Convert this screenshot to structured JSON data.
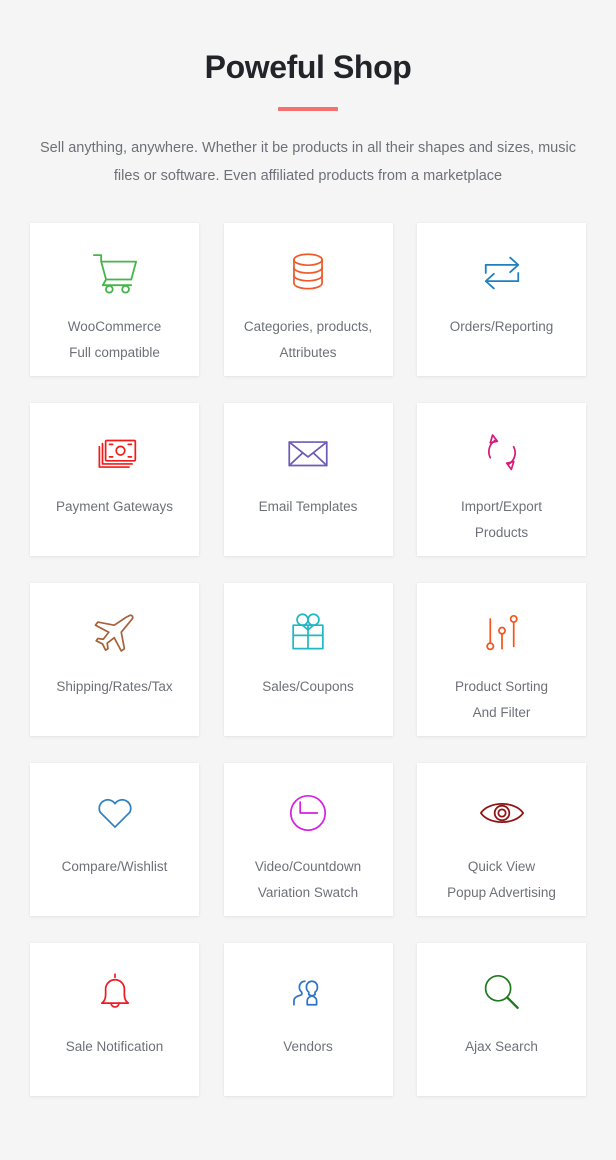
{
  "header": {
    "title": "Poweful Shop",
    "accent_color": "#f4706f",
    "subtitle": "Sell anything, anywhere. Whether it be products in all their shapes and sizes, music files or software. Even affiliated products from a marketplace"
  },
  "background_color": "#f5f5f5",
  "card_background": "#ffffff",
  "label_color": "#6d7177",
  "cards": [
    {
      "icon": "shopping-cart-icon",
      "color": "#44b549",
      "label": "WooCommerce\nFull compatible"
    },
    {
      "icon": "database-stack-icon",
      "color": "#f05a28",
      "label": "Categories, products,\nAttributes"
    },
    {
      "icon": "swap-arrows-icon",
      "color": "#1f80c0",
      "label": "Orders/Reporting"
    },
    {
      "icon": "banknotes-icon",
      "color": "#f51a1a",
      "label": "Payment Gateways"
    },
    {
      "icon": "envelope-icon",
      "color": "#6e5ab8",
      "label": "Email Templates"
    },
    {
      "icon": "sync-arrows-icon",
      "color": "#d61a7a",
      "label": "Import/Export\nProducts"
    },
    {
      "icon": "airplane-icon",
      "color": "#a8623c",
      "label": "Shipping/Rates/Tax"
    },
    {
      "icon": "gift-box-icon",
      "color": "#21b8c6",
      "label": "Sales/Coupons"
    },
    {
      "icon": "sliders-icon",
      "color": "#f4541d",
      "label": "Product Sorting\nAnd Filter"
    },
    {
      "icon": "heart-icon",
      "color": "#2f7fc1",
      "label": "Compare/Wishlist"
    },
    {
      "icon": "clock-circle-icon",
      "color": "#d420e0",
      "label": "Video/Countdown\nVariation Swatch"
    },
    {
      "icon": "eye-icon",
      "color": "#8e1515",
      "label": "Quick View\nPopup Advertising"
    },
    {
      "icon": "bell-icon",
      "color": "#ef1b24",
      "label": "Sale Notification"
    },
    {
      "icon": "users-group-icon",
      "color": "#2f73c6",
      "label": "Vendors"
    },
    {
      "icon": "magnifier-search-icon",
      "color": "#1d7a1d",
      "label": "Ajax Search"
    }
  ]
}
